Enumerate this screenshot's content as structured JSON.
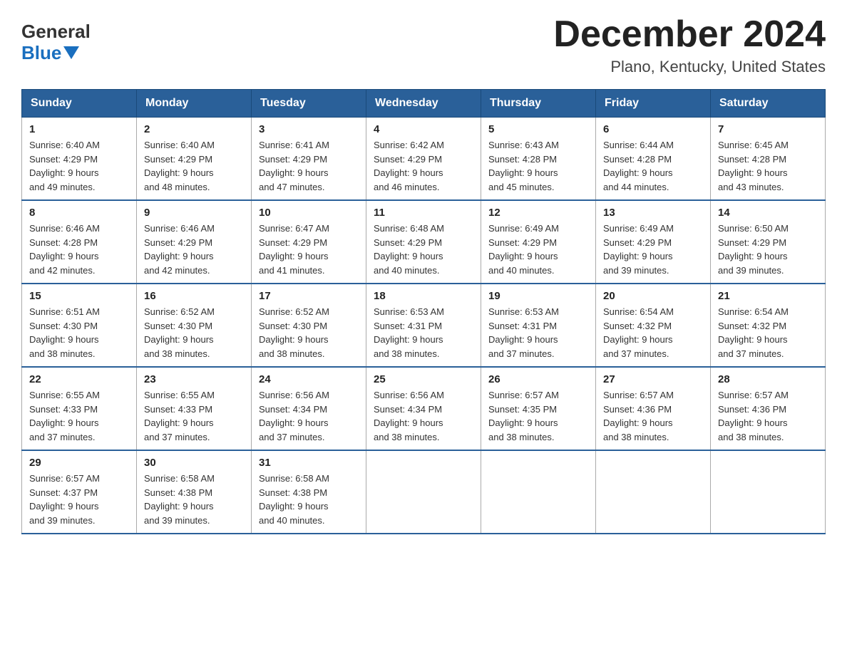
{
  "logo": {
    "general": "General",
    "blue": "Blue"
  },
  "header": {
    "title": "December 2024",
    "subtitle": "Plano, Kentucky, United States"
  },
  "weekdays": [
    "Sunday",
    "Monday",
    "Tuesday",
    "Wednesday",
    "Thursday",
    "Friday",
    "Saturday"
  ],
  "weeks": [
    [
      {
        "day": "1",
        "sunrise": "6:40 AM",
        "sunset": "4:29 PM",
        "daylight": "9 hours and 49 minutes."
      },
      {
        "day": "2",
        "sunrise": "6:40 AM",
        "sunset": "4:29 PM",
        "daylight": "9 hours and 48 minutes."
      },
      {
        "day": "3",
        "sunrise": "6:41 AM",
        "sunset": "4:29 PM",
        "daylight": "9 hours and 47 minutes."
      },
      {
        "day": "4",
        "sunrise": "6:42 AM",
        "sunset": "4:29 PM",
        "daylight": "9 hours and 46 minutes."
      },
      {
        "day": "5",
        "sunrise": "6:43 AM",
        "sunset": "4:28 PM",
        "daylight": "9 hours and 45 minutes."
      },
      {
        "day": "6",
        "sunrise": "6:44 AM",
        "sunset": "4:28 PM",
        "daylight": "9 hours and 44 minutes."
      },
      {
        "day": "7",
        "sunrise": "6:45 AM",
        "sunset": "4:28 PM",
        "daylight": "9 hours and 43 minutes."
      }
    ],
    [
      {
        "day": "8",
        "sunrise": "6:46 AM",
        "sunset": "4:28 PM",
        "daylight": "9 hours and 42 minutes."
      },
      {
        "day": "9",
        "sunrise": "6:46 AM",
        "sunset": "4:29 PM",
        "daylight": "9 hours and 42 minutes."
      },
      {
        "day": "10",
        "sunrise": "6:47 AM",
        "sunset": "4:29 PM",
        "daylight": "9 hours and 41 minutes."
      },
      {
        "day": "11",
        "sunrise": "6:48 AM",
        "sunset": "4:29 PM",
        "daylight": "9 hours and 40 minutes."
      },
      {
        "day": "12",
        "sunrise": "6:49 AM",
        "sunset": "4:29 PM",
        "daylight": "9 hours and 40 minutes."
      },
      {
        "day": "13",
        "sunrise": "6:49 AM",
        "sunset": "4:29 PM",
        "daylight": "9 hours and 39 minutes."
      },
      {
        "day": "14",
        "sunrise": "6:50 AM",
        "sunset": "4:29 PM",
        "daylight": "9 hours and 39 minutes."
      }
    ],
    [
      {
        "day": "15",
        "sunrise": "6:51 AM",
        "sunset": "4:30 PM",
        "daylight": "9 hours and 38 minutes."
      },
      {
        "day": "16",
        "sunrise": "6:52 AM",
        "sunset": "4:30 PM",
        "daylight": "9 hours and 38 minutes."
      },
      {
        "day": "17",
        "sunrise": "6:52 AM",
        "sunset": "4:30 PM",
        "daylight": "9 hours and 38 minutes."
      },
      {
        "day": "18",
        "sunrise": "6:53 AM",
        "sunset": "4:31 PM",
        "daylight": "9 hours and 38 minutes."
      },
      {
        "day": "19",
        "sunrise": "6:53 AM",
        "sunset": "4:31 PM",
        "daylight": "9 hours and 37 minutes."
      },
      {
        "day": "20",
        "sunrise": "6:54 AM",
        "sunset": "4:32 PM",
        "daylight": "9 hours and 37 minutes."
      },
      {
        "day": "21",
        "sunrise": "6:54 AM",
        "sunset": "4:32 PM",
        "daylight": "9 hours and 37 minutes."
      }
    ],
    [
      {
        "day": "22",
        "sunrise": "6:55 AM",
        "sunset": "4:33 PM",
        "daylight": "9 hours and 37 minutes."
      },
      {
        "day": "23",
        "sunrise": "6:55 AM",
        "sunset": "4:33 PM",
        "daylight": "9 hours and 37 minutes."
      },
      {
        "day": "24",
        "sunrise": "6:56 AM",
        "sunset": "4:34 PM",
        "daylight": "9 hours and 37 minutes."
      },
      {
        "day": "25",
        "sunrise": "6:56 AM",
        "sunset": "4:34 PM",
        "daylight": "9 hours and 38 minutes."
      },
      {
        "day": "26",
        "sunrise": "6:57 AM",
        "sunset": "4:35 PM",
        "daylight": "9 hours and 38 minutes."
      },
      {
        "day": "27",
        "sunrise": "6:57 AM",
        "sunset": "4:36 PM",
        "daylight": "9 hours and 38 minutes."
      },
      {
        "day": "28",
        "sunrise": "6:57 AM",
        "sunset": "4:36 PM",
        "daylight": "9 hours and 38 minutes."
      }
    ],
    [
      {
        "day": "29",
        "sunrise": "6:57 AM",
        "sunset": "4:37 PM",
        "daylight": "9 hours and 39 minutes."
      },
      {
        "day": "30",
        "sunrise": "6:58 AM",
        "sunset": "4:38 PM",
        "daylight": "9 hours and 39 minutes."
      },
      {
        "day": "31",
        "sunrise": "6:58 AM",
        "sunset": "4:38 PM",
        "daylight": "9 hours and 40 minutes."
      },
      null,
      null,
      null,
      null
    ]
  ],
  "labels": {
    "sunrise": "Sunrise:",
    "sunset": "Sunset:",
    "daylight": "Daylight:"
  }
}
